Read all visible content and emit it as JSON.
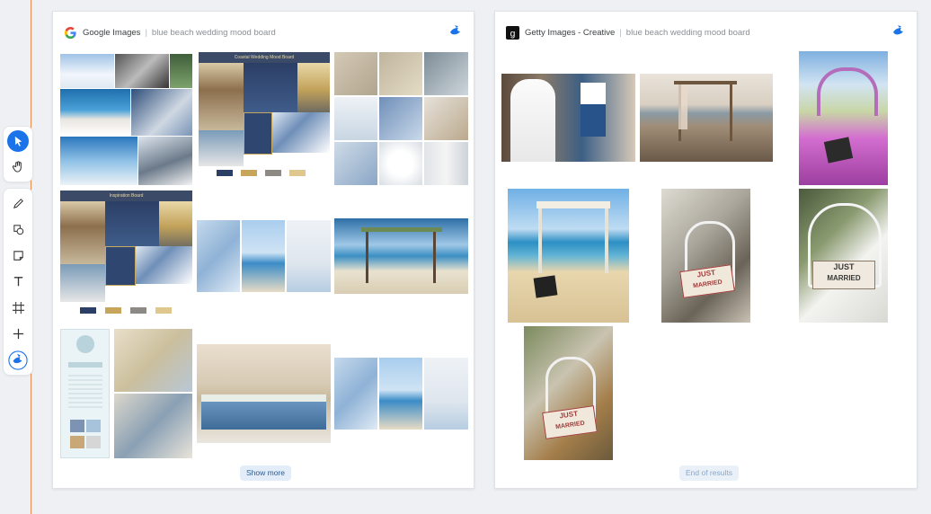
{
  "toolbar": {
    "tools": [
      "select-arrow",
      "hand",
      "pencil",
      "shapes",
      "sticky-note",
      "text",
      "frame",
      "add",
      "bird-logo"
    ]
  },
  "left_panel": {
    "source_name": "Google Images",
    "separator": "|",
    "query": "blue beach wedding mood board",
    "show_more_label": "Show more",
    "board_title_1": "Coastal Wedding Mood Board",
    "board_title_2": "Inspiration Board"
  },
  "right_panel": {
    "source_name": "Getty Images - Creative",
    "separator": "|",
    "query": "blue beach wedding mood board",
    "end_label": "End of results",
    "sign_text_1": "JUST",
    "sign_text_2": "MARRIED"
  },
  "colors": {
    "accent": "#1a73e8",
    "guide": "#e88a4e",
    "navy": "#2b3f66"
  }
}
